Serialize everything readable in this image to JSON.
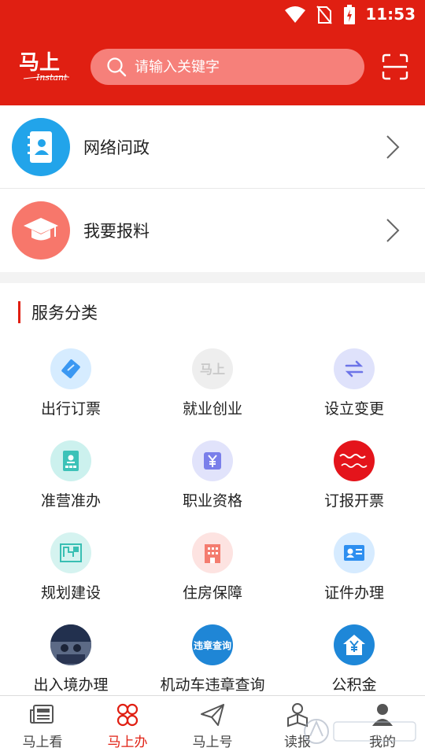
{
  "status_bar": {
    "time": "11:53"
  },
  "header": {
    "logo_text": "马上",
    "logo_sub": "Instant",
    "search_placeholder": "请输入关键字"
  },
  "features": [
    {
      "label": "网络问政",
      "icon": "contacts-book-icon",
      "color": "#22a4ea"
    },
    {
      "label": "我要报料",
      "icon": "graduation-cap-icon",
      "color": "#f7776b"
    }
  ],
  "section": {
    "title": "服务分类"
  },
  "services": [
    {
      "label": "出行订票",
      "icon": "ticket-icon",
      "bg": "#d6ecff"
    },
    {
      "label": "就业创业",
      "icon": "mashang-logo-icon",
      "bg": "#eeeeee"
    },
    {
      "label": "设立变更",
      "icon": "swap-arrows-icon",
      "bg": "#dfe2fb"
    },
    {
      "label": "准营准办",
      "icon": "id-card-icon",
      "bg": "#ccf1ee"
    },
    {
      "label": "职业资格",
      "icon": "yuan-badge-icon",
      "bg": "#e1e3fb"
    },
    {
      "label": "订报开票",
      "icon": "newspaper-seal-icon",
      "bg": "#e4141b"
    },
    {
      "label": "规划建设",
      "icon": "blueprint-icon",
      "bg": "#d5f3f0"
    },
    {
      "label": "住房保障",
      "icon": "building-icon",
      "bg": "#fde3e1"
    },
    {
      "label": "证件办理",
      "icon": "license-card-icon",
      "bg": "#d6ebff"
    },
    {
      "label": "出入境办理",
      "icon": "photo-thumbnail-icon",
      "bg": "#3a4a6a"
    },
    {
      "label": "机动车违章查询",
      "icon": "violation-query-icon",
      "bg": "#1f86d6",
      "icon_text": "违章查询"
    },
    {
      "label": "公积金",
      "icon": "house-fund-icon",
      "bg": "#1e87d8"
    }
  ],
  "nav": [
    {
      "label": "马上看",
      "icon": "newspaper-icon",
      "active": false
    },
    {
      "label": "马上办",
      "icon": "four-petal-icon",
      "active": true
    },
    {
      "label": "马上号",
      "icon": "paper-plane-icon",
      "active": false
    },
    {
      "label": "读报",
      "icon": "reader-icon",
      "active": false
    },
    {
      "label": "我的",
      "icon": "profile-icon",
      "active": false
    }
  ],
  "colors": {
    "brand_red": "#e01f12",
    "text": "#222222"
  }
}
